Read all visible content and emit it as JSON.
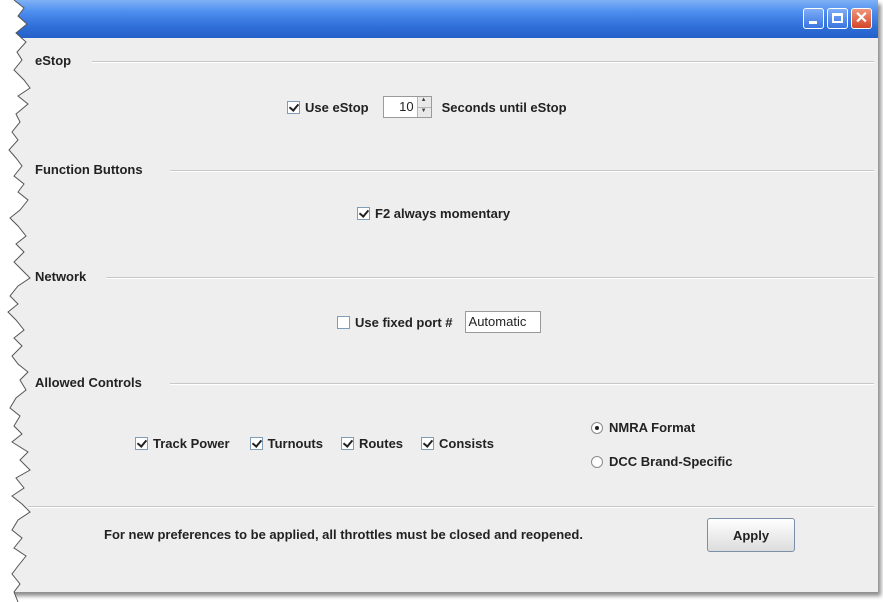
{
  "window": {
    "title": "",
    "controls": [
      "minimize-icon",
      "maximize-icon",
      "close-icon"
    ]
  },
  "estop": {
    "section_label": "eStop",
    "use_estop_label": "Use eStop",
    "use_estop_checked": true,
    "seconds_value": "10",
    "seconds_label": "Seconds until eStop"
  },
  "function_buttons": {
    "section_label": "Function Buttons",
    "f2_label": "F2 always momentary",
    "f2_checked": true
  },
  "network": {
    "section_label": "Network",
    "fixed_port_label": "Use fixed port #",
    "fixed_port_checked": false,
    "port_value": "Automatic"
  },
  "allowed_controls": {
    "section_label": "Allowed Controls",
    "checkboxes": [
      {
        "label": "Track Power",
        "checked": true
      },
      {
        "label": "Turnouts",
        "checked": true
      },
      {
        "label": "Routes",
        "checked": true
      },
      {
        "label": "Consists",
        "checked": true
      }
    ],
    "radios": [
      {
        "label": "NMRA Format",
        "selected": true
      },
      {
        "label": "DCC Brand-Specific",
        "selected": false
      }
    ]
  },
  "footer": {
    "message": "For new preferences to be applied, all throttles must be closed and reopened.",
    "apply_label": "Apply"
  },
  "colors": {
    "titlebar": "#2f6fd8",
    "panel_background": "#eeeeee",
    "close_button": "#d2472a"
  }
}
